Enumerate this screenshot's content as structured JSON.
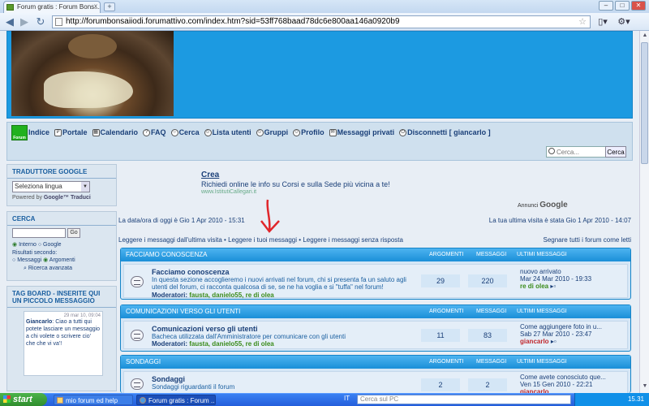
{
  "browser": {
    "tab_title": "Forum gratis : Forum Bons...",
    "tab_close": "x",
    "new_tab": "+",
    "url": "http://forumbonsaiiodi.forumattivo.com/index.htm?sid=53ff768baad78dc6e800aa146a0920b9"
  },
  "nav": {
    "logo_text": "Forum",
    "items": [
      {
        "label": "Indice"
      },
      {
        "label": "Portale"
      },
      {
        "label": "Calendario"
      },
      {
        "label": "FAQ"
      },
      {
        "label": "Cerca"
      },
      {
        "label": "Lista utenti"
      },
      {
        "label": "Gruppi"
      },
      {
        "label": "Profilo"
      },
      {
        "label": "Messaggi privati"
      },
      {
        "label": "Disconnetti [ giancarlo ]"
      }
    ],
    "search_placeholder": "Cerca...",
    "search_button": "Cerca"
  },
  "sidebar": {
    "translator_title": "TRADUTTORE GOOGLE",
    "language_select": "Seleziona lingua",
    "powered_by": "Powered by",
    "google_translate": "Google™ Traduci",
    "search_title": "CERCA",
    "search_go": "Go",
    "radio_internal": "Interno",
    "radio_google": "Google",
    "results_label": "Risultati secondo:",
    "radio_messages": "Messaggi",
    "radio_topics": "Argomenti",
    "advanced_search": "Ricerca avanzata",
    "tagboard_title": "TAG BOARD - INSERITE QUI UN PICCOLO MESSAGGIO",
    "tag_time": "29 mar 10, 09:04",
    "tag_user": "Giancarlo",
    "tag_message": "Ciao a tutti qui potete lasciare un messaggio a chi volete o scrivere cio' che che vi va'!"
  },
  "ad": {
    "title": "Crea",
    "description": "Richiedi online le info su Corsi e sulla Sede più vicina a te!",
    "url": "www.IstitutiCallegari.it",
    "annunci": "Annunci",
    "google": "Google"
  },
  "info": {
    "current_time": "La data/ora di oggi è Gio 1 Apr 2010 - 15:31",
    "last_visit": "La tua ultima visita è stata Gio 1 Apr 2010 - 14:07",
    "read_since_last": "Leggere i messaggi dall'ultima visita",
    "read_mine": "Leggere i tuoi messaggi",
    "read_unanswered": "Leggere i messaggi senza risposta",
    "mark_read": "Segnare tutti i forum come letti",
    "separator": "•"
  },
  "columns": {
    "topics": "ARGOMENTI",
    "posts": "MESSAGGI",
    "last_posts": "ULTIMI MESSAGGI"
  },
  "categories": [
    {
      "title": "FACCIAMO CONOSCENZA",
      "forum": {
        "name": "Facciamo conoscenza",
        "description": "In questa sezione accoglieremo i nuovi arrivati nel forum, chi si presenta fa un saluto agli utenti del forum, ci racconta qualcosa di se, se ne ha voglia e si \"tuffa\" nel forum!",
        "moderators_label": "Moderatori:",
        "moderators": "fausta, danielo55, re di olea",
        "topics": "29",
        "posts": "220",
        "last_title": "nuovo arrivato",
        "last_date": "Mar 24 Mar 2010 - 19:33",
        "last_user": "re di olea"
      }
    },
    {
      "title": "COMUNICAZIONI VERSO GLI UTENTI",
      "forum": {
        "name": "Comunicazioni verso gli utenti",
        "description": "Bacheca utilizzata dall'Amministratore per comunicare con gli utenti",
        "moderators_label": "Moderatori:",
        "moderators": "fausta, danielo55, re di olea",
        "topics": "11",
        "posts": "83",
        "last_title": "Come aggiungere foto in u...",
        "last_date": "Sab 27 Mar 2010 - 23:47",
        "last_user": "giancarlo"
      }
    },
    {
      "title": "SONDAGGI",
      "forum": {
        "name": "Sondaggi",
        "description": "Sondaggi riguardanti il forum",
        "topics": "2",
        "posts": "2",
        "last_title": "Come avete conosciuto que...",
        "last_date": "Ven 15 Gen 2010 - 22:21",
        "last_user": "giancarlo"
      }
    }
  ],
  "taskbar": {
    "start": "start",
    "task1": "mio forum ed help",
    "task2": "Forum gratis : Forum ...",
    "lang": "IT",
    "search_placeholder": "Cerca sul PC",
    "clock": "15.31"
  },
  "colors": {
    "header_blue": "#1c9ae1",
    "link_blue": "#1a3f78",
    "moderator_green": "#3a8b1a",
    "user_red": "#c0282d"
  }
}
